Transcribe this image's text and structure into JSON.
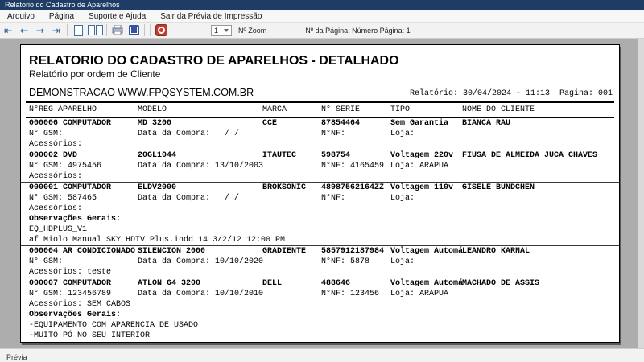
{
  "window": {
    "title": "Relatorio do Cadastro de Aparelhos"
  },
  "menu": {
    "items": [
      "Arquivo",
      "Página",
      "Suporte e Ajuda",
      "Sair da Prévia de Impressão"
    ]
  },
  "toolbar": {
    "zoom_value": "1",
    "zoom_label": "Nº Zoom",
    "page_label": "Nº da Página: Número Página: 1",
    "icons": [
      "first-page",
      "previous-page",
      "next-page",
      "last-page",
      "single-page-view",
      "two-page-view",
      "print",
      "print-setup",
      "exit-preview"
    ]
  },
  "statusbar": {
    "label": "Prévia"
  },
  "colors": {
    "titlebar": "#1e3c64",
    "nav_blue": "#3a6ea5",
    "setup_blue": "#35529e",
    "exit_red": "#c23b2e",
    "page_surround": "#adadad"
  },
  "report": {
    "title": "RELATORIO DO CADASTRO DE APARELHOS - DETALHADO",
    "subtitle": "Relatório por ordem de Cliente",
    "company": "DEMONSTRACAO WWW.FPQSYSTEM.COM.BR",
    "meta": "Relatório: 30/04/2024 - 11:13  Pagina: 001",
    "columns": [
      "N°REG APARELHO",
      "MODELO",
      "MARCA",
      "N° SERIE",
      "TIPO",
      "NOME DO CLIENTE"
    ],
    "records": [
      {
        "reg": "000006 COMPUTADOR",
        "modelo": "MD 3200",
        "marca": "CCE",
        "serie": "87854464",
        "tipo": "Sem Garantia",
        "cliente": "BIANCA RAU",
        "gsm": "N° GSM:",
        "compra": "Data da Compra:   / /",
        "nf": "N°NF:",
        "loja": "Loja:",
        "acessorios": "Acessórios:"
      },
      {
        "reg": "000002 DVD",
        "modelo": "20GL1044",
        "marca": "ITAUTEC",
        "serie": "598754",
        "tipo": "Voltagem 220v",
        "cliente": "FIUSA DE ALMEIDA JUCA CHAVES",
        "gsm": "N° GSM: 4975456",
        "compra": "Data da Compra: 13/10/2003",
        "nf": "N°NF: 4165459",
        "loja": "Loja: ARAPUA",
        "acessorios": "Acessórios:"
      },
      {
        "reg": "000001 COMPUTADOR",
        "modelo": "ELDV2000",
        "marca": "BROKSONIC",
        "serie": "48987562164ZZ",
        "tipo": "Voltagem 110v",
        "cliente": "GISELE BÜNDCHEN",
        "gsm": "N° GSM: 587465",
        "compra": "Data da Compra:   / /",
        "nf": "N°NF:",
        "loja": "Loja:",
        "acessorios": "Acessórios:",
        "obs_label": "Observações Gerais:",
        "obs_lines": [
          "EQ_HDPLUS_V1",
          "af Miolo Manual SKY HDTV Plus.indd 14 3/2/12 12:00 PM"
        ]
      },
      {
        "reg": "000004 AR CONDICIONADO",
        "modelo": "SILENCION 2000",
        "marca": "GRADIENTE",
        "serie": "5857912187984",
        "tipo": "Voltagem Automá",
        "cliente": "LEANDRO KARNAL",
        "gsm": "N° GSM:",
        "compra": "Data da Compra: 10/10/2020",
        "nf": "N°NF: 5878",
        "loja": "Loja:",
        "acessorios": "Acessórios: teste"
      },
      {
        "reg": "000007 COMPUTADOR",
        "modelo": "ATLON 64 3200",
        "marca": "DELL",
        "serie": "488646",
        "tipo": "Voltagem Automá",
        "cliente": "MACHADO DE ASSIS",
        "gsm": "N° GSM: 123456789",
        "compra": "Data da Compra: 10/10/2010",
        "nf": "N°NF: 123456",
        "loja": "Loja: ARAPUA",
        "acessorios": "Acessórios: SEM CABOS",
        "obs_label": "Observações Gerais:",
        "obs_lines": [
          "-EQUIPAMENTO COM APARENCIA DE USADO",
          "-MUITO PÓ NO SEU INTERIOR"
        ]
      }
    ]
  }
}
